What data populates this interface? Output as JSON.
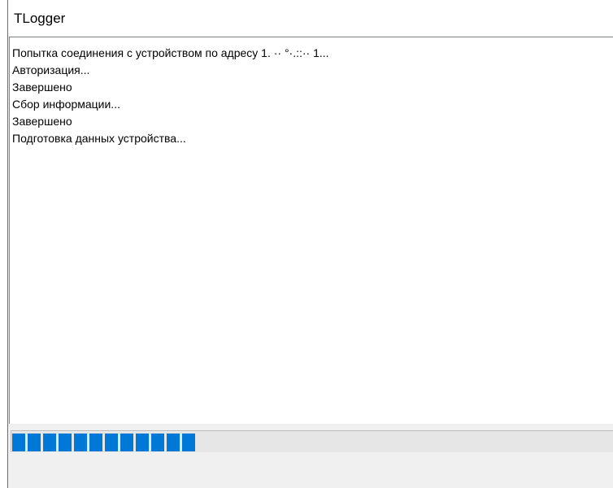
{
  "window": {
    "title": "TLogger"
  },
  "log": {
    "lines": [
      "Попытка соединения с устройством по адресу 1.  ·· °·.::·· 1...",
      "Авторизация...",
      "Завершено",
      "Сбор информации...",
      "Завершено",
      "Подготовка данных устройства..."
    ]
  },
  "progress": {
    "fraction": 0.31,
    "color": "#0078d7"
  }
}
